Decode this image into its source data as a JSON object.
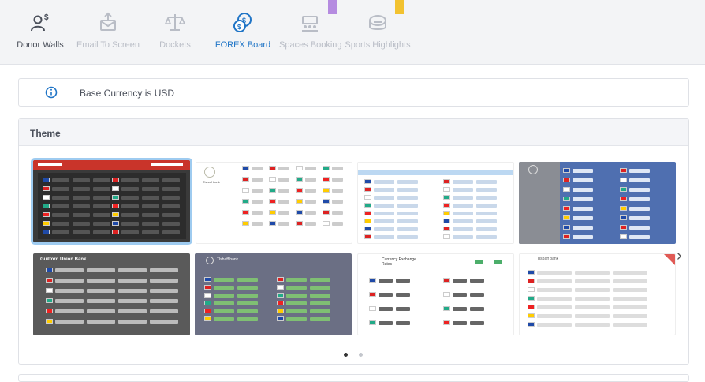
{
  "tabs": [
    {
      "label": "Donor Walls",
      "icon": "donor-dollar-icon",
      "state": "normal"
    },
    {
      "label": "Email To Screen",
      "icon": "email-upload-icon",
      "state": "disabled"
    },
    {
      "label": "Dockets",
      "icon": "scales-icon",
      "state": "disabled"
    },
    {
      "label": "FOREX Board",
      "icon": "currency-exchange-icon",
      "state": "active"
    },
    {
      "label": "Spaces Booking",
      "icon": "meeting-room-icon",
      "state": "disabled"
    },
    {
      "label": "Sports Highlights",
      "icon": "stadium-icon",
      "state": "disabled"
    }
  ],
  "info": {
    "text": "Base Currency is USD",
    "icon": "info-icon"
  },
  "theme": {
    "title": "Theme",
    "thumb_texts": {
      "t5_title": "Guilford Union Bank",
      "t6_title": "Tlsbaff bank",
      "t7_title": "Currency Exchange Rates",
      "t8_title": "Tlsbaff bank",
      "t2_title": "Tlsbaff bank"
    },
    "selected_index": 0,
    "page_count": 2,
    "current_page": 0
  },
  "colors": {
    "accent": "#1f74c6",
    "purple_ribbon": "#b58be0",
    "yellow_ribbon": "#f2c230",
    "selected_outline": "#9ecbf0"
  }
}
